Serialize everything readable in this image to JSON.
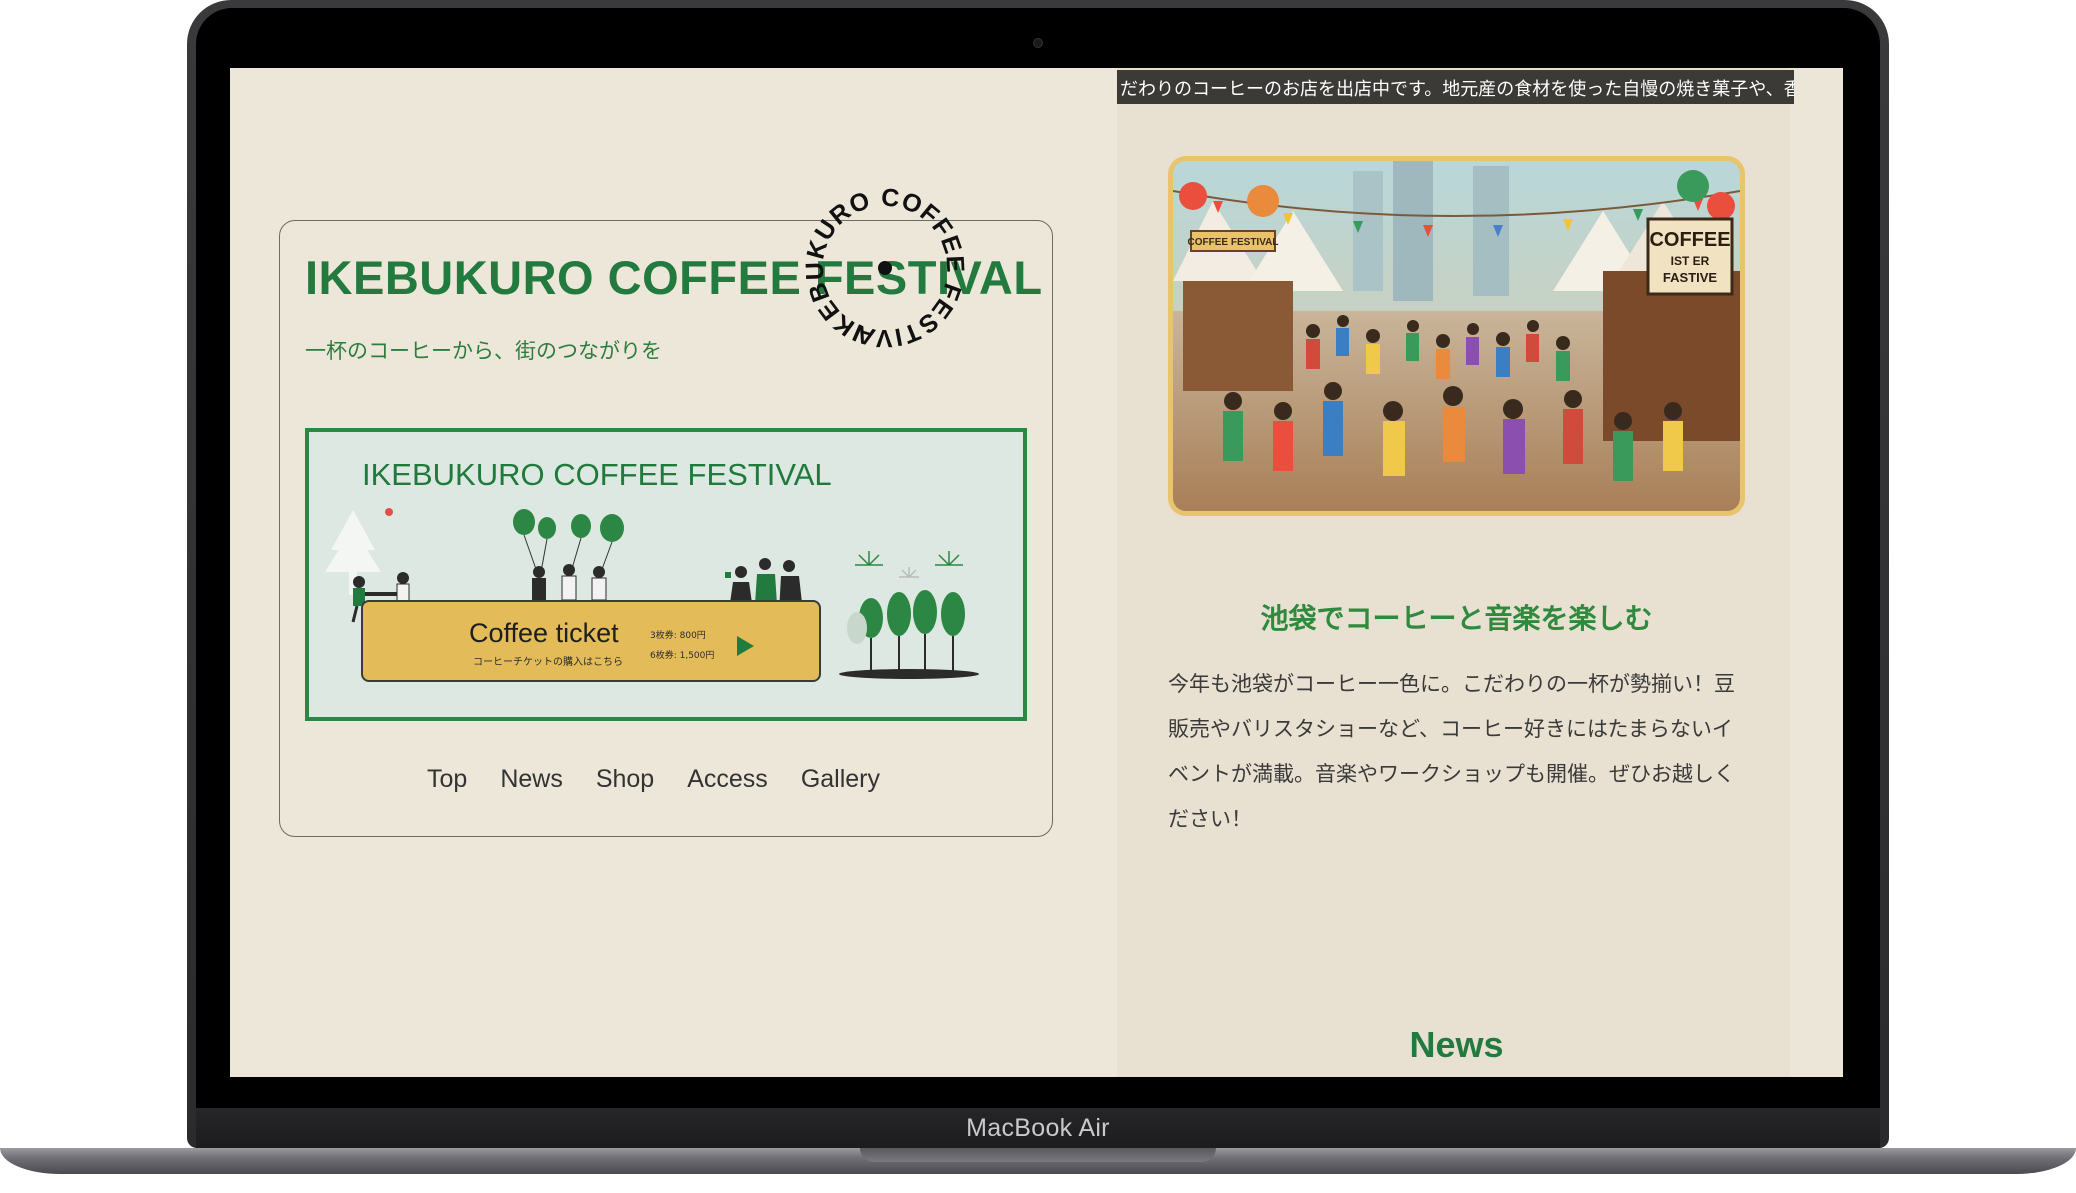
{
  "device": {
    "label": "MacBook Air"
  },
  "header": {
    "site_title": "IKEBUKURO COFFEE FESTIVAL",
    "tagline": "一杯のコーヒーから、街のつながりを",
    "badge_text": "IKEBUKURO COFFEE FESTIVAL"
  },
  "banner": {
    "title": "IKEBUKURO COFFEE FESTIVAL",
    "ticket_title": "Coffee ticket",
    "ticket_subtitle": "コーヒーチケットの購入はこちら",
    "price_3": "3枚券:  800円",
    "price_6": "6枚券: 1,500円"
  },
  "nav": {
    "items": [
      {
        "label": "Top"
      },
      {
        "label": "News"
      },
      {
        "label": "Shop"
      },
      {
        "label": "Access"
      },
      {
        "label": "Gallery"
      }
    ]
  },
  "ticker": {
    "text": "だわりのコーヒーのお店を出店中です。地元産の食材を使った自慢の焼き菓子や、香り"
  },
  "intro": {
    "title": "池袋でコーヒーと音楽を楽しむ",
    "body": "今年も池袋がコーヒー一色に。こだわりの一杯が勢揃い！豆販売やバリスタショーなど、コーヒー好きにはたまらないイベントが満載。音楽やワークショップも開催。ぜひお越しください！"
  },
  "hero_sign": {
    "coffee": "COFFEE",
    "line2": "IST ER",
    "line3": "FASTIVE",
    "left_sign": "COFFEE FESTIVAL"
  },
  "news": {
    "title": "News"
  },
  "colors": {
    "brand_green": "#237a3f",
    "ticket_yellow": "#e3bc59",
    "page_bg": "#ede7da"
  }
}
